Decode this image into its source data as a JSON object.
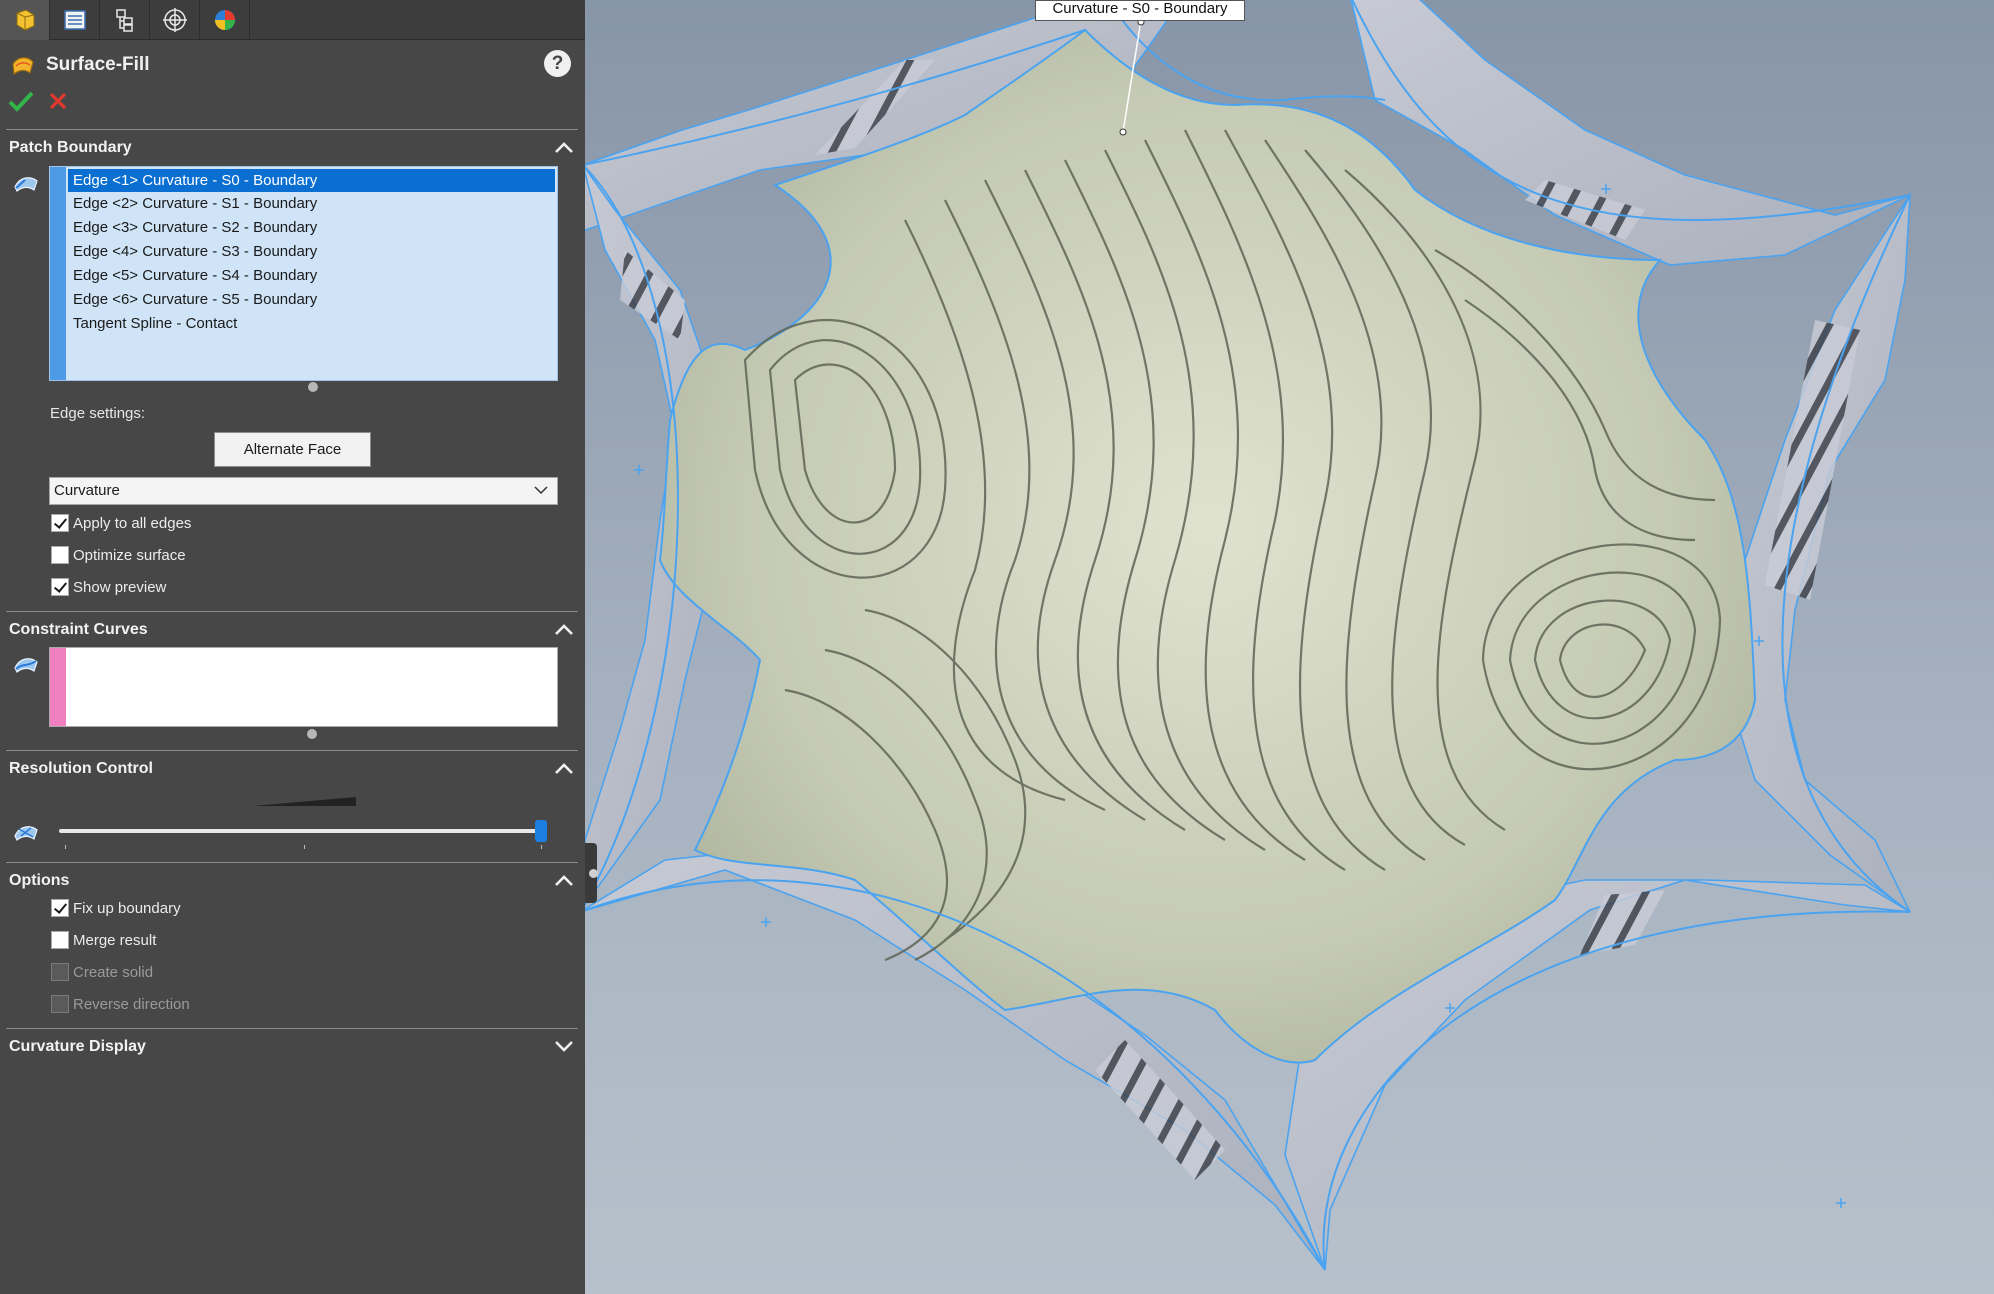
{
  "tabs": [
    {
      "name": "feature-manager-icon"
    },
    {
      "name": "property-manager-icon"
    },
    {
      "name": "configuration-manager-icon"
    },
    {
      "name": "dimxpert-manager-icon"
    },
    {
      "name": "display-manager-icon"
    }
  ],
  "feature": {
    "title": "Surface-Fill",
    "help_label": "?",
    "accent": "#0a6fd1"
  },
  "patch_boundary": {
    "header": "Patch Boundary",
    "items": [
      "Edge <1> Curvature - S0 - Boundary",
      "Edge <2> Curvature - S1 - Boundary",
      "Edge <3> Curvature - S2 - Boundary",
      "Edge <4> Curvature - S3 - Boundary",
      "Edge <5> Curvature - S4 - Boundary",
      "Edge <6> Curvature - S5 - Boundary",
      "Tangent Spline - Contact"
    ],
    "selected_index": 0,
    "edge_settings_label": "Edge settings:",
    "alternate_face_label": "Alternate Face",
    "condition_value": "Curvature",
    "apply_all_label": "Apply to all edges",
    "apply_all_checked": true,
    "optimize_label": "Optimize surface",
    "optimize_checked": false,
    "preview_label": "Show preview",
    "preview_checked": true
  },
  "constraint_curves": {
    "header": "Constraint Curves",
    "stripe_color": "#f080c0"
  },
  "resolution_control": {
    "header": "Resolution Control",
    "slider_value": 1.0
  },
  "options": {
    "header": "Options",
    "fix_boundary_label": "Fix up boundary",
    "fix_boundary_checked": true,
    "merge_label": "Merge result",
    "merge_checked": false,
    "create_solid_label": "Create solid",
    "create_solid_enabled": false,
    "reverse_label": "Reverse direction",
    "reverse_enabled": false
  },
  "curvature_display": {
    "header": "Curvature Display"
  },
  "viewport": {
    "callout_label": "Curvature - S0 - Boundary",
    "edge_color": "#4aa3f0",
    "surface_color": "#c5cab4"
  }
}
